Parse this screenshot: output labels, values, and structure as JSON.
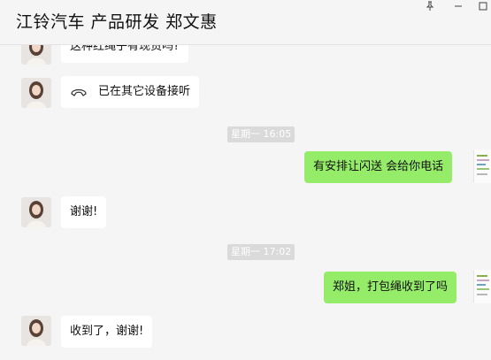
{
  "window": {
    "title": "江铃汽车 产品研发 郑文惠"
  },
  "messages": [
    {
      "side": "left",
      "text": "这种红绳子有现货吗?"
    },
    {
      "side": "left",
      "text": "已在其它设备接听",
      "icon": "phone-hangup-icon"
    },
    {
      "type": "timestamp",
      "text": "星期一 16:05"
    },
    {
      "side": "right",
      "text": "有安排让闪送  会给你电话"
    },
    {
      "side": "left",
      "text": "谢谢!"
    },
    {
      "type": "timestamp",
      "text": "星期一 17:02"
    },
    {
      "side": "right",
      "text": "郑姐，打包绳收到了吗"
    },
    {
      "side": "left",
      "text": "收到了，谢谢!"
    }
  ],
  "colors": {
    "outgoing_bubble": "#95ec69",
    "incoming_bubble": "#ffffff",
    "background": "#f5f5f5"
  }
}
